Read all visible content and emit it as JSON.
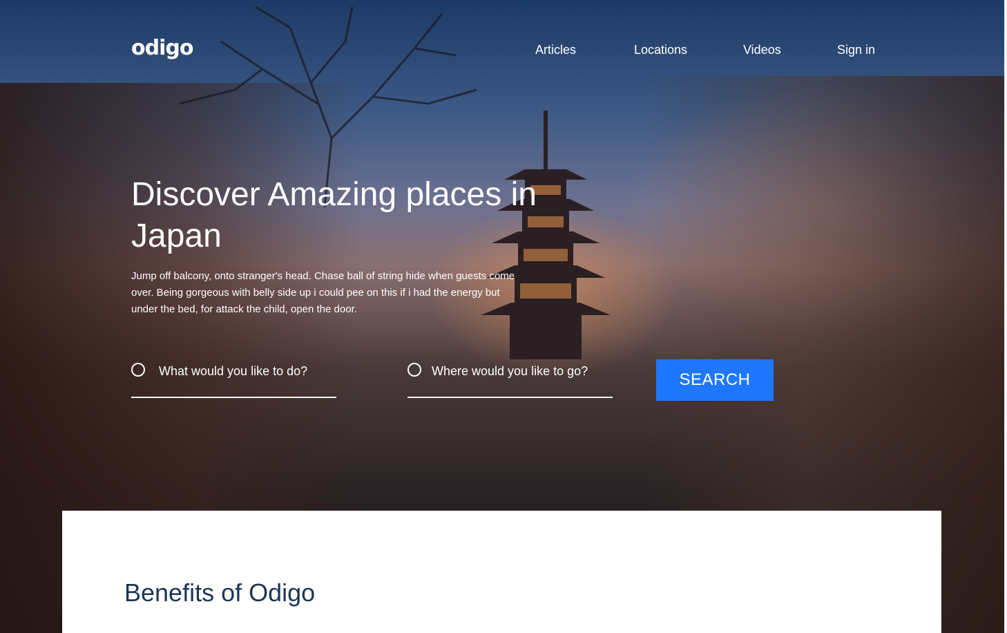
{
  "brand": {
    "logo": "odigo"
  },
  "nav": {
    "items": [
      {
        "label": "Articles"
      },
      {
        "label": "Locations"
      },
      {
        "label": "Videos"
      },
      {
        "label": "Sign in"
      }
    ]
  },
  "hero": {
    "headline": "Discover Amazing places in Japan",
    "lead": "Jump off balcony, onto stranger's head. Chase ball of string hide when guests come over. Being gorgeous with belly side up i could pee on this if i had the energy but under the bed, for attack the child, open the door."
  },
  "search": {
    "activity_placeholder": "What would you like to do?",
    "location_placeholder": "Where would you like to go?",
    "button_label": "SEARCH"
  },
  "benefits": {
    "title": "Benefits of Odigo"
  },
  "colors": {
    "accent": "#1f77ff",
    "heading": "#1b3553"
  }
}
